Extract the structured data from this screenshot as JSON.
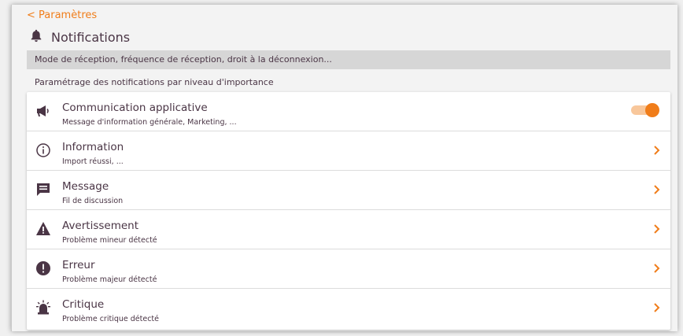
{
  "header": {
    "back_label": "< Paramètres",
    "title": "Notifications",
    "title_icon": "bell-icon"
  },
  "description": "Mode de réception, fréquence de réception, droit à la déconnexion...",
  "section_title": "Paramétrage des notifications par niveau d'importance",
  "colors": {
    "accent": "#f07d1a",
    "text": "#4a3545",
    "toggle_track": "#f8c79b"
  },
  "items": [
    {
      "label": "Communication applicative",
      "sub": "Message d'information générale, Marketing, ...",
      "icon": "megaphone-icon",
      "control": "toggle",
      "enabled": true
    },
    {
      "label": "Information",
      "sub": "Import réussi, ...",
      "icon": "info-icon",
      "control": "chevron"
    },
    {
      "label": "Message",
      "sub": "Fil de discussion",
      "icon": "message-icon",
      "control": "chevron"
    },
    {
      "label": "Avertissement",
      "sub": "Problème mineur détecté",
      "icon": "warning-icon",
      "control": "chevron"
    },
    {
      "label": "Erreur",
      "sub": "Problème majeur détecté",
      "icon": "error-icon",
      "control": "chevron"
    },
    {
      "label": "Critique",
      "sub": "Problème critique détecté",
      "icon": "siren-icon",
      "control": "chevron"
    }
  ]
}
